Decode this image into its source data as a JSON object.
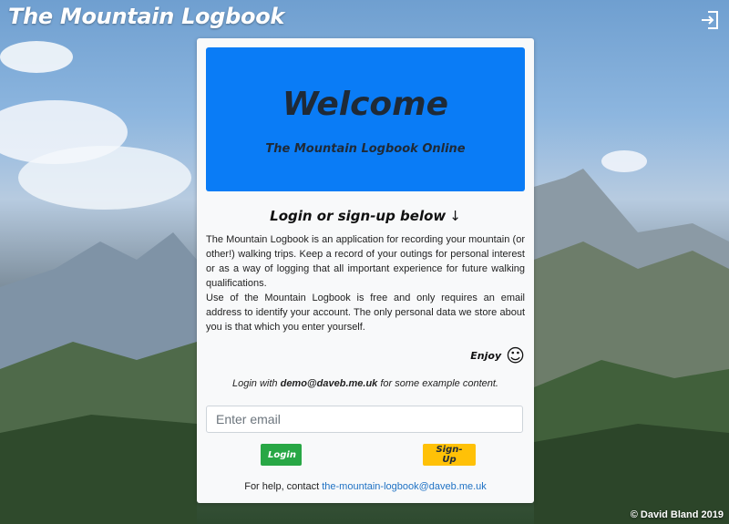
{
  "app": {
    "title": "The Mountain Logbook"
  },
  "header": {
    "logout_icon": "logout-icon"
  },
  "card": {
    "hero_title": "Welcome",
    "hero_subtitle": "The Mountain Logbook Online",
    "login_heading": "Login or sign-up below",
    "login_arrow": "↓",
    "paragraph1": "The Mountain Logbook is an application for recording your mountain (or other!) walking trips. Keep a record of your outings for personal interest or as a way of logging that all important experience for future walking qualifications.",
    "paragraph2": "Use of the Mountain Logbook is free and only requires an email address to identify your account. The only personal data we store about you is that which you enter yourself.",
    "enjoy": "Enjoy",
    "enjoy_icon": "☺",
    "demo_prefix": "Login with ",
    "demo_email": "demo@daveb.me.uk",
    "demo_suffix": " for some example content.",
    "email_placeholder": "Enter email",
    "email_value": "",
    "login_button": "Login",
    "signup_button": "Sign-Up",
    "help_prefix": "For help, contact ",
    "help_email": "the-mountain-logbook@daveb.me.uk"
  },
  "footer": {
    "copyright": "© David Bland 2019"
  },
  "colors": {
    "hero": "#0a7cf6",
    "login": "#28a745",
    "signup": "#ffc107",
    "link": "#1f72c4"
  }
}
